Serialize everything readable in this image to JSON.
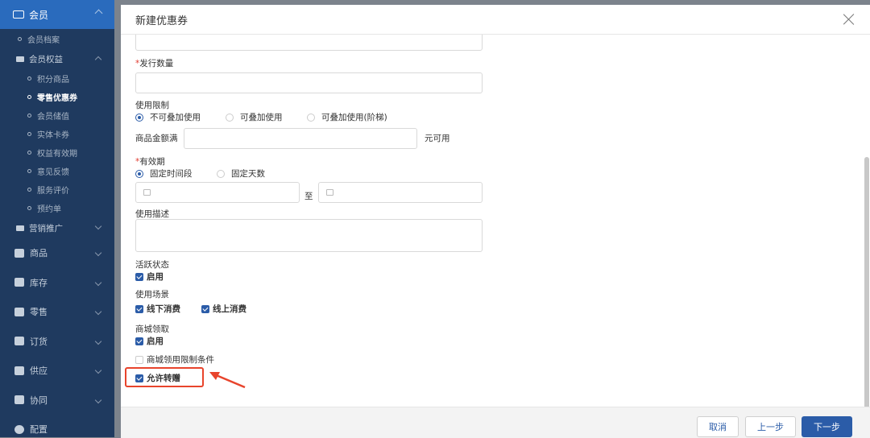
{
  "sidebar": {
    "header": "会员",
    "items": [
      {
        "label": "会员档案"
      },
      {
        "label": "会员权益"
      },
      {
        "label": "积分商品"
      },
      {
        "label": "零售优惠券"
      },
      {
        "label": "会员储值"
      },
      {
        "label": "实体卡券"
      },
      {
        "label": "权益有效期"
      },
      {
        "label": "意见反馈"
      },
      {
        "label": "服务评价"
      },
      {
        "label": "预约单"
      },
      {
        "label": "营销推广"
      }
    ],
    "nav": [
      {
        "label": "商品"
      },
      {
        "label": "库存"
      },
      {
        "label": "零售"
      },
      {
        "label": "订货"
      },
      {
        "label": "供应"
      },
      {
        "label": "协同"
      },
      {
        "label": "配置"
      }
    ]
  },
  "modal": {
    "title": "新建优惠券",
    "issue_qty_label": "发行数量",
    "usage_limit_label": "使用限制",
    "usage_options": [
      "不可叠加使用",
      "可叠加使用",
      "可叠加使用(阶梯)"
    ],
    "amount_label": "商品金额满",
    "amount_suffix": "元可用",
    "validity_label": "有效期",
    "validity_options": [
      "固定时间段",
      "固定天数"
    ],
    "date_to": "至",
    "desc_label": "使用描述",
    "active_label": "活跃状态",
    "active_enable": "启用",
    "scene_label": "使用场景",
    "scene_offline": "线下消费",
    "scene_online": "线上消费",
    "mall_label": "商城领取",
    "mall_enable": "启用",
    "mall_limit": "商城领用限制条件",
    "allow_gift": "允许转赠",
    "required_mark": "*"
  },
  "footer": {
    "cancel": "取消",
    "prev": "上一步",
    "next": "下一步"
  },
  "colors": {
    "accent": "#2b5ca8",
    "sidebar_bg": "#1f3a5f",
    "highlight": "#e8442c"
  }
}
